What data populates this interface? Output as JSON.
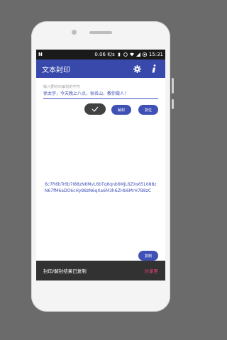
{
  "statusbar": {
    "left_icon": "N",
    "speed": "0.06 K/s",
    "time": "15:31"
  },
  "appbar": {
    "title": "文本封印"
  },
  "input": {
    "placeholder": "输入要封印/解封的字符",
    "value": "徐太宇，今天晚上八点，秋名山，教你做人！"
  },
  "buttons": {
    "decode": "解封",
    "reset": "复位",
    "copy": "复制"
  },
  "output": {
    "text": "6c7R6bTr6b7I88zN6MvL6bTq6qnb6MjL6ZXs65L688zN67fM6aDO6cHy88zN6qXa6M3h6ZHb6MrH7B8zC"
  },
  "snackbar": {
    "message": "封印/解封结果已复制",
    "action": "分享至"
  },
  "colors": {
    "primary": "#3949ab",
    "accent": "#ff4081"
  }
}
